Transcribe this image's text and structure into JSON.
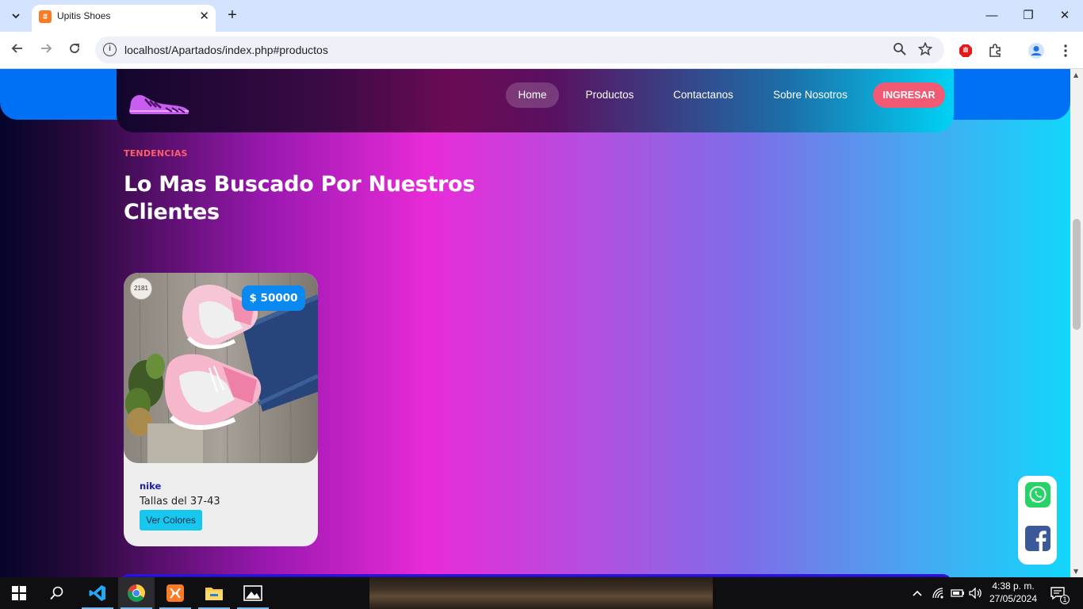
{
  "browser": {
    "tab_title": "Upitis Shoes",
    "tab_close": "✕",
    "new_tab": "+",
    "url": "localhost/Apartados/index.php#productos",
    "window_controls": {
      "minimize": "—",
      "restore": "❐",
      "close": "✕"
    }
  },
  "nav": {
    "items": [
      {
        "label": "Home"
      },
      {
        "label": "Productos"
      },
      {
        "label": "Contactanos"
      },
      {
        "label": "Sobre Nosotros"
      }
    ],
    "login_label": "INGRESAR"
  },
  "section": {
    "eyebrow": "TENDENCIAS",
    "title": "Lo Mas Buscado Por Nuestros Clientes"
  },
  "product": {
    "badge": "2181",
    "price": "$ 50000",
    "brand": "nike",
    "sizes": "Tallas del 37-43",
    "button_label": "Ver Colores"
  },
  "social": {
    "icons": [
      "whatsapp-icon",
      "facebook-icon"
    ]
  },
  "taskbar": {
    "apps": [
      "windows-start-icon",
      "search-icon",
      "vscode-icon",
      "chrome-icon",
      "xampp-icon",
      "file-explorer-icon",
      "photos-icon"
    ],
    "time": "4:38 p. m.",
    "date": "27/05/2024",
    "notification_count": "1"
  },
  "colors": {
    "navbar_strip": "#0070f5",
    "login_button": "#f25a74",
    "price_tag": "#0a8af1",
    "ver_colores_button": "#17c7ee",
    "brand_text": "#1b1eb4",
    "eyebrow_text": "#ff5d6a"
  }
}
